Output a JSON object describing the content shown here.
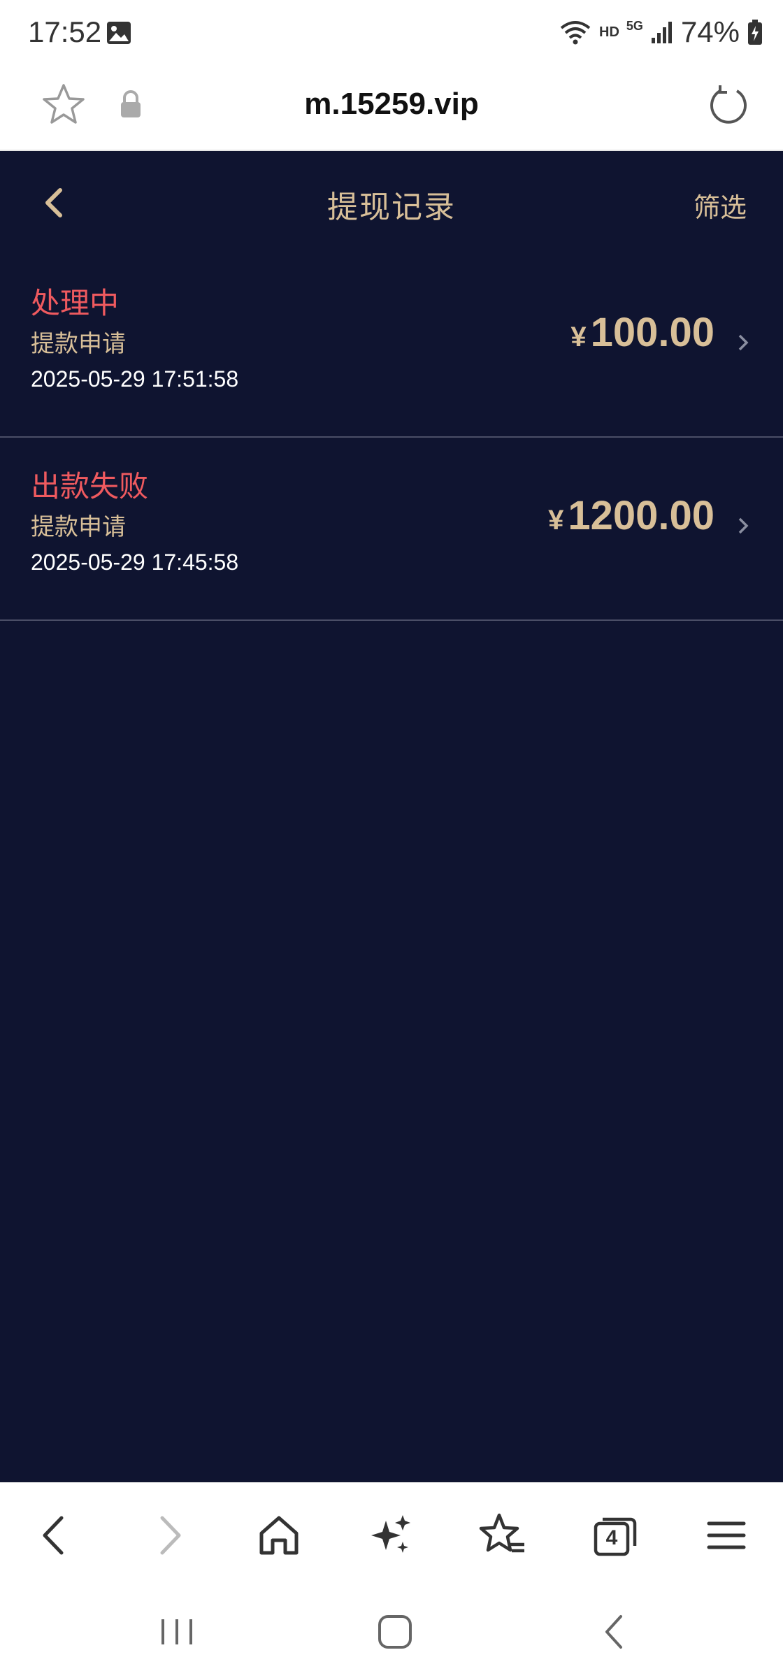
{
  "status_bar": {
    "time": "17:52",
    "network": "HD",
    "network_gen": "5G",
    "battery": "74%"
  },
  "address_bar": {
    "url": "m.15259.vip"
  },
  "header": {
    "title": "提现记录",
    "filter_label": "筛选"
  },
  "records": [
    {
      "status": "处理中",
      "type": "提款申请",
      "time": "2025-05-29 17:51:58",
      "currency": "¥",
      "amount": "100.00"
    },
    {
      "status": "出款失败",
      "type": "提款申请",
      "time": "2025-05-29 17:45:58",
      "currency": "¥",
      "amount": "1200.00"
    }
  ],
  "toolbar": {
    "tabs_count": "4"
  },
  "colors": {
    "background": "#0f1430",
    "accent_gold": "#d8bf98",
    "status_red": "#ef5a5f"
  }
}
